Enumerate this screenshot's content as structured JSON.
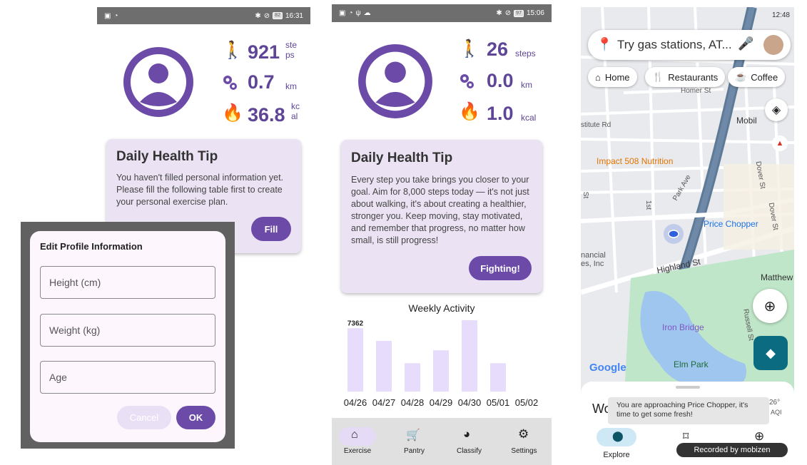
{
  "panel1": {
    "status": {
      "time": "16:31",
      "battery": "82"
    },
    "stats": {
      "steps": "921",
      "steps_unit": "ste\nps",
      "distance": "0.7",
      "distance_unit": "km",
      "calories": "36.8",
      "calories_unit": "kc\nal"
    },
    "tip": {
      "title": "Daily Health Tip",
      "body": "You haven't filled personal information yet. Please fill the following table first to create your personal exercise plan.",
      "button": "Fill"
    },
    "dialog": {
      "title": "Edit Profile Information",
      "height_placeholder": "Height (cm)",
      "weight_placeholder": "Weight (kg)",
      "age_placeholder": "Age",
      "cancel": "Cancel",
      "ok": "OK"
    }
  },
  "panel2": {
    "status": {
      "time": "15:06",
      "battery": "97"
    },
    "stats": {
      "steps": "26",
      "steps_unit": "steps",
      "distance": "0.0",
      "distance_unit": "km",
      "calories": "1.0",
      "calories_unit": "kcal"
    },
    "tip": {
      "title": "Daily Health Tip",
      "body": "Every step you take brings you closer to your goal. Aim for 8,000 steps today — it's not just about walking, it's about creating a healthier, stronger you. Keep moving, stay motivated, and remember that progress, no matter how small, is still progress!",
      "button": "Fighting!"
    },
    "chart_title": "Weekly Activity",
    "chart_data": {
      "type": "bar",
      "title": "Weekly Activity",
      "categories": [
        "04/26",
        "04/27",
        "04/28",
        "04/29",
        "04/30",
        "05/01",
        "05/02"
      ],
      "values": [
        7362,
        5900,
        3300,
        4800,
        8300,
        3300,
        0
      ],
      "data_labels": [
        "7362",
        "",
        "",
        "",
        "",
        "",
        ""
      ],
      "color": "#e8dcfc"
    },
    "nav": [
      {
        "label": "Exercise",
        "icon": "home-icon",
        "active": true
      },
      {
        "label": "Pantry",
        "icon": "cart-icon",
        "active": false
      },
      {
        "label": "Classify",
        "icon": "compass-icon",
        "active": false
      },
      {
        "label": "Settings",
        "icon": "gear-icon",
        "active": false
      }
    ]
  },
  "panel3": {
    "status": {
      "time": "12:48"
    },
    "search_placeholder": "Try gas stations, AT...",
    "chips": [
      "Home",
      "Restaurants",
      "Coffee"
    ],
    "places": {
      "mobil": "Mobil",
      "impact": "Impact 508 Nutrition",
      "price_chopper": "Price Chopper",
      "iron_bridge": "Iron Bridge",
      "elm_park": "Elm Park",
      "matthew": "Matthew",
      "financial": "nancial\nes, Inc",
      "institute": "stitute Rd",
      "homer": "Homer St",
      "highland": "Highland St",
      "park_ave": "Park Ave",
      "dover1": "Dover St",
      "dover2": "Dover St",
      "russell": "Russell St",
      "st_left": "St",
      "st_mid": "1st",
      "google": "Google"
    },
    "sheet_left": "Wo",
    "weather_temp": "26°",
    "weather_aqi": "AQI",
    "toast": "You are approaching Price Chopper, it's time to get some fresh!",
    "recorded": "Recorded by mobizen",
    "explore": "Explore"
  }
}
